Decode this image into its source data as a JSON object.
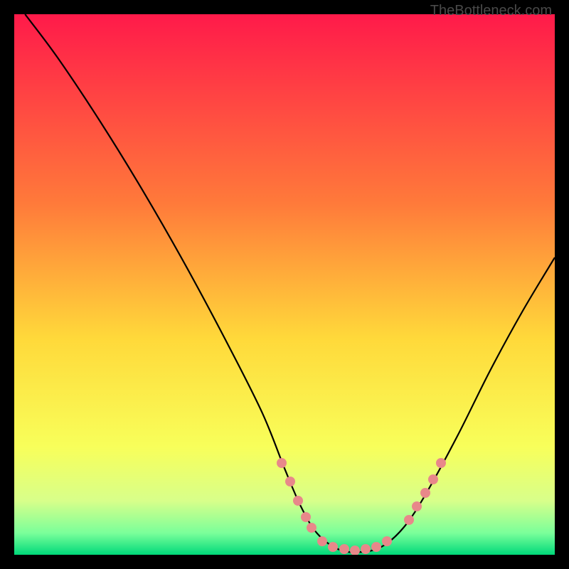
{
  "watermark": "TheBottleneck.com",
  "chart_data": {
    "type": "line",
    "title": "",
    "xlabel": "",
    "ylabel": "",
    "xlim": [
      0,
      100
    ],
    "ylim": [
      0,
      100
    ],
    "gradient_stops": [
      {
        "offset": 0,
        "color": "#ff1a4a"
      },
      {
        "offset": 35,
        "color": "#ff7a3a"
      },
      {
        "offset": 60,
        "color": "#ffd93a"
      },
      {
        "offset": 80,
        "color": "#f8ff5a"
      },
      {
        "offset": 90,
        "color": "#d8ff8a"
      },
      {
        "offset": 96,
        "color": "#7aff9a"
      },
      {
        "offset": 100,
        "color": "#00d97a"
      }
    ],
    "curve": [
      {
        "x": 2,
        "y": 100
      },
      {
        "x": 8,
        "y": 92
      },
      {
        "x": 16,
        "y": 80
      },
      {
        "x": 24,
        "y": 67
      },
      {
        "x": 32,
        "y": 53
      },
      {
        "x": 40,
        "y": 38
      },
      {
        "x": 46,
        "y": 26
      },
      {
        "x": 50,
        "y": 16
      },
      {
        "x": 53,
        "y": 9
      },
      {
        "x": 56,
        "y": 4
      },
      {
        "x": 60,
        "y": 1
      },
      {
        "x": 64,
        "y": 0.5
      },
      {
        "x": 68,
        "y": 1.5
      },
      {
        "x": 72,
        "y": 5
      },
      {
        "x": 76,
        "y": 11
      },
      {
        "x": 82,
        "y": 22
      },
      {
        "x": 88,
        "y": 34
      },
      {
        "x": 94,
        "y": 45
      },
      {
        "x": 100,
        "y": 55
      }
    ],
    "highlight_dots": [
      {
        "x": 49.5,
        "y": 17
      },
      {
        "x": 51,
        "y": 13.5
      },
      {
        "x": 52.5,
        "y": 10
      },
      {
        "x": 54,
        "y": 7
      },
      {
        "x": 55,
        "y": 5
      },
      {
        "x": 57,
        "y": 2.5
      },
      {
        "x": 59,
        "y": 1.5
      },
      {
        "x": 61,
        "y": 1
      },
      {
        "x": 63,
        "y": 0.8
      },
      {
        "x": 65,
        "y": 1
      },
      {
        "x": 67,
        "y": 1.5
      },
      {
        "x": 69,
        "y": 2.5
      },
      {
        "x": 73,
        "y": 6.5
      },
      {
        "x": 74.5,
        "y": 9
      },
      {
        "x": 76,
        "y": 11.5
      },
      {
        "x": 77.5,
        "y": 14
      },
      {
        "x": 79,
        "y": 17
      }
    ]
  }
}
